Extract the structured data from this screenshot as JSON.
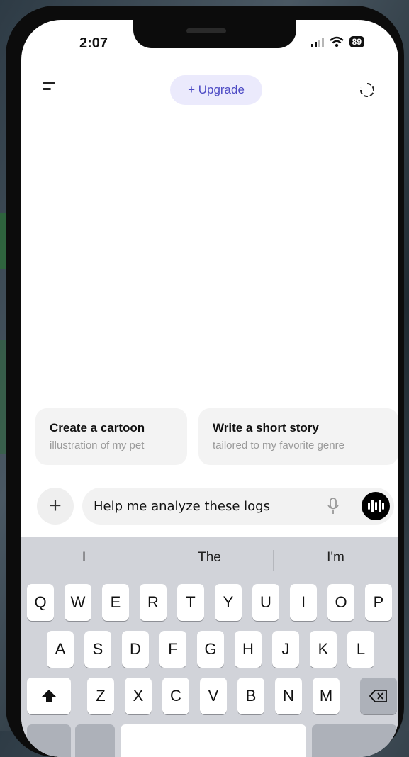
{
  "status_bar": {
    "time": "2:07",
    "battery": "89"
  },
  "header": {
    "upgrade_label": "+ Upgrade"
  },
  "suggestions": [
    {
      "title": "Create a cartoon",
      "subtitle": "illustration of my pet"
    },
    {
      "title": "Write a short story",
      "subtitle": "tailored to my favorite genre"
    }
  ],
  "composer": {
    "input_value": "Help me analyze these logs"
  },
  "keyboard": {
    "predictions": [
      "I",
      "The",
      "I'm"
    ],
    "row1": [
      "Q",
      "W",
      "E",
      "R",
      "T",
      "Y",
      "U",
      "I",
      "O",
      "P"
    ],
    "row2": [
      "A",
      "S",
      "D",
      "F",
      "G",
      "H",
      "J",
      "K",
      "L"
    ],
    "row3": [
      "Z",
      "X",
      "C",
      "V",
      "B",
      "N",
      "M"
    ]
  },
  "colors": {
    "accent": "#4c4ac4",
    "upgrade_bg": "#ebeafc",
    "keyboard_bg": "#d1d3d9"
  }
}
